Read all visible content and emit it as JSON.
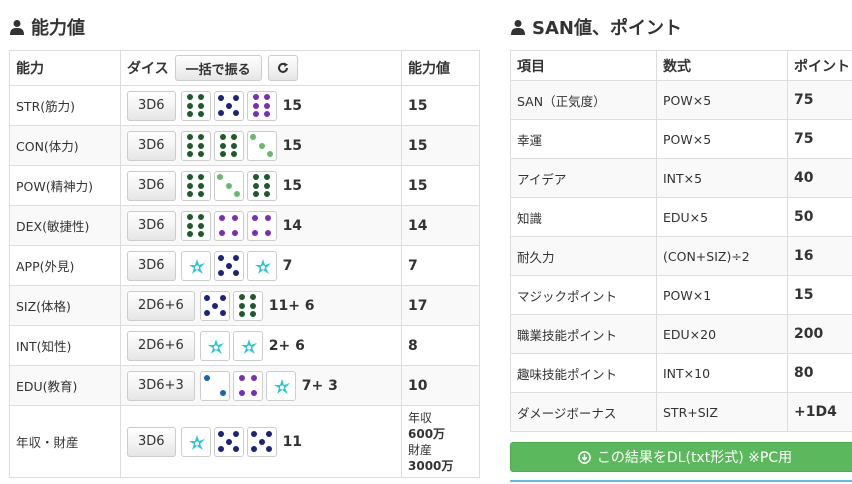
{
  "left": {
    "title": "能力値",
    "headers": {
      "name": "能力",
      "dice": "ダイス",
      "roll_all": "一括で振る",
      "value": "能力値"
    },
    "rows": [
      {
        "name": "STR(筋力)",
        "formula": "3D6",
        "dice": [
          {
            "n": 6,
            "c": "#1e5b2b"
          },
          {
            "n": 5,
            "c": "#1a237e"
          },
          {
            "n": 6,
            "c": "#7b2cb8"
          }
        ],
        "total": "15",
        "value": "15"
      },
      {
        "name": "CON(体力)",
        "formula": "3D6",
        "dice": [
          {
            "n": 6,
            "c": "#1e5b2b"
          },
          {
            "n": 6,
            "c": "#1e5b2b"
          },
          {
            "n": 3,
            "c": "#66bb6a"
          }
        ],
        "total": "15",
        "value": "15"
      },
      {
        "name": "POW(精神力)",
        "formula": "3D6",
        "dice": [
          {
            "n": 6,
            "c": "#1e5b2b"
          },
          {
            "n": 3,
            "c": "#66bb6a"
          },
          {
            "n": 6,
            "c": "#1e5b2b"
          }
        ],
        "total": "15",
        "value": "15"
      },
      {
        "name": "DEX(敏捷性)",
        "formula": "3D6",
        "dice": [
          {
            "n": 6,
            "c": "#1e5b2b"
          },
          {
            "n": 4,
            "c": "#7b2cb8"
          },
          {
            "n": 4,
            "c": "#7b2cb8"
          }
        ],
        "total": "14",
        "value": "14"
      },
      {
        "name": "APP(外見)",
        "formula": "3D6",
        "dice": [
          {
            "n": 1,
            "c": "#26c6da"
          },
          {
            "n": 5,
            "c": "#1a237e"
          },
          {
            "n": 1,
            "c": "#26c6da"
          }
        ],
        "total": "7",
        "value": "7"
      },
      {
        "name": "SIZ(体格)",
        "formula": "2D6+6",
        "dice": [
          {
            "n": 5,
            "c": "#1a237e"
          },
          {
            "n": 6,
            "c": "#1e5b2b"
          }
        ],
        "total": "11+ 6",
        "value": "17"
      },
      {
        "name": "INT(知性)",
        "formula": "2D6+6",
        "dice": [
          {
            "n": 1,
            "c": "#26c6da"
          },
          {
            "n": 1,
            "c": "#26c6da"
          }
        ],
        "total": "2+ 6",
        "value": "8"
      },
      {
        "name": "EDU(教育)",
        "formula": "3D6+3",
        "dice": [
          {
            "n": 2,
            "c": "#1565c0"
          },
          {
            "n": 4,
            "c": "#7b2cb8"
          },
          {
            "n": 1,
            "c": "#26c6da"
          }
        ],
        "total": "7+ 3",
        "value": "10"
      },
      {
        "name": "年収・財産",
        "formula": "3D6",
        "dice": [
          {
            "n": 1,
            "c": "#26c6da"
          },
          {
            "n": 5,
            "c": "#1a237e"
          },
          {
            "n": 5,
            "c": "#1a237e"
          }
        ],
        "total": "11",
        "income_label": "年収",
        "income": "600万",
        "assets_label": "財産",
        "assets": "3000万"
      }
    ]
  },
  "right": {
    "title": "SAN値、ポイント",
    "headers": {
      "item": "項目",
      "formula": "数式",
      "points": "ポイント"
    },
    "rows": [
      {
        "item": "SAN（正気度）",
        "formula": "POW×5",
        "points": "75"
      },
      {
        "item": "幸運",
        "formula": "POW×5",
        "points": "75"
      },
      {
        "item": "アイデア",
        "formula": "INT×5",
        "points": "40"
      },
      {
        "item": "知識",
        "formula": "EDU×5",
        "points": "50"
      },
      {
        "item": "耐久力",
        "formula": "(CON+SIZ)÷2",
        "points": "16"
      },
      {
        "item": "マジックポイント",
        "formula": "POW×1",
        "points": "15"
      },
      {
        "item": "職業技能ポイント",
        "formula": "EDU×20",
        "points": "200"
      },
      {
        "item": "趣味技能ポイント",
        "formula": "INT×10",
        "points": "80"
      },
      {
        "item": "ダメージボーナス",
        "formula": "STR+SIZ",
        "points": "+1D4"
      }
    ],
    "download_label": "この結果をDL(txt形式) ※PC用"
  },
  "colors": {
    "accent_green": "#5cb85c",
    "info_blue": "#5bc0de"
  }
}
